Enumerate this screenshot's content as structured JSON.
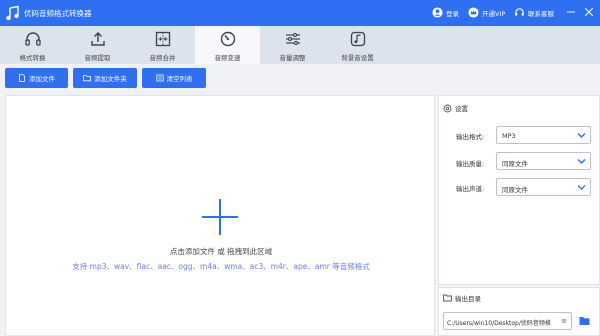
{
  "app": {
    "title": "优码音频格式转换器",
    "login_label": "登录",
    "vip_label": "开通VIP",
    "support_label": "联系客服"
  },
  "tabs": [
    {
      "label": "格式转换",
      "icon": "headphones-icon",
      "active": false
    },
    {
      "label": "音频提取",
      "icon": "upload-icon",
      "active": false
    },
    {
      "label": "音频合并",
      "icon": "merge-icon",
      "active": false
    },
    {
      "label": "音频变速",
      "icon": "speed-dial-icon",
      "active": true
    },
    {
      "label": "音量调整",
      "icon": "sliders-icon",
      "active": false
    },
    {
      "label": "背景音设置",
      "icon": "music-note-icon",
      "active": false
    }
  ],
  "toolbar": {
    "add_file_label": "添加文件",
    "add_folder_label": "添加文件夹",
    "clear_list_label": "清空列表"
  },
  "dropzone": {
    "hint": "点击添加文件 或 拖拽到此区域",
    "formats": "支持 mp3、wav、flac、aac、ogg、m4a、wma、ac3、m4r、ape、amr 等音频格式"
  },
  "settings": {
    "title": "设置",
    "format_label": "输出格式:",
    "format_value": "MP3",
    "quality_label": "输出质量:",
    "quality_value": "同原文件",
    "channel_label": "输出声道:",
    "channel_value": "同原文件"
  },
  "output": {
    "title": "输出目录",
    "path": "C:/Users/win10/Desktop/优码音频格"
  },
  "colors": {
    "accent": "#2f6ff2",
    "formats_text": "#6b7fd6"
  }
}
